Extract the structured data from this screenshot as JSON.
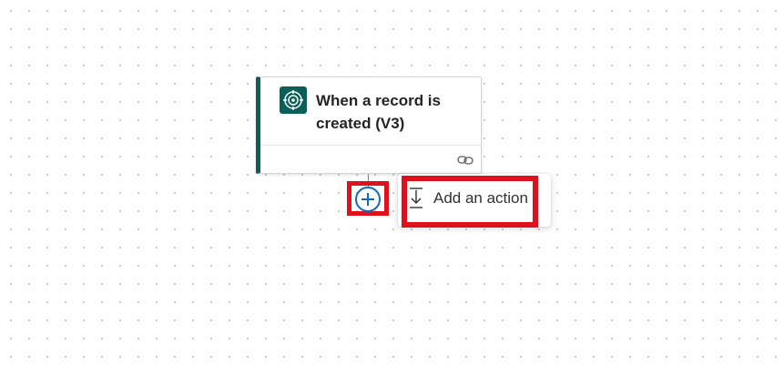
{
  "trigger_card": {
    "title": "When a record is created (V3)",
    "icon": "dataverse-icon",
    "link_icon": "link-icon",
    "accent_color": "#0b5f59"
  },
  "add_step": {
    "icon": "plus-circle-icon",
    "accent_color": "#0f6cbd"
  },
  "menu": {
    "add_action_label": "Add an action",
    "add_action_icon": "insert-step-icon"
  },
  "highlight_color": "#e0101d"
}
